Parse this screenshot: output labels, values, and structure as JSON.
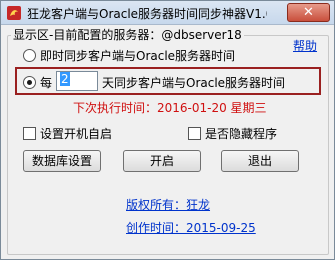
{
  "window": {
    "title": "狂龙客户端与Oracle服务器时间同步神器V1.0...",
    "close_glyph": "✕"
  },
  "group": {
    "label": "显示区-目前配置的服务器：@dbserver18",
    "help": "帮助"
  },
  "sync_options": {
    "immediate_label": "即时同步客户端与Oracle服务器时间",
    "every_prefix": "每",
    "days_value": "2",
    "every_suffix": "天同步客户端与Oracle服务器时间",
    "selected": "every"
  },
  "next_run": {
    "text": "下次执行时间：2016-01-20  星期三",
    "color": "#d01010"
  },
  "checkboxes": {
    "autostart": "设置开机自启",
    "hide": "是否隐藏程序"
  },
  "buttons": {
    "db_settings": "数据库设置",
    "start": "开启",
    "exit": "退出"
  },
  "footer": {
    "copyright": "版权所有：狂龙",
    "created": "创作时间：2015-09-25"
  },
  "colors": {
    "highlight_border": "#9a2020",
    "link": "#0033cc"
  }
}
